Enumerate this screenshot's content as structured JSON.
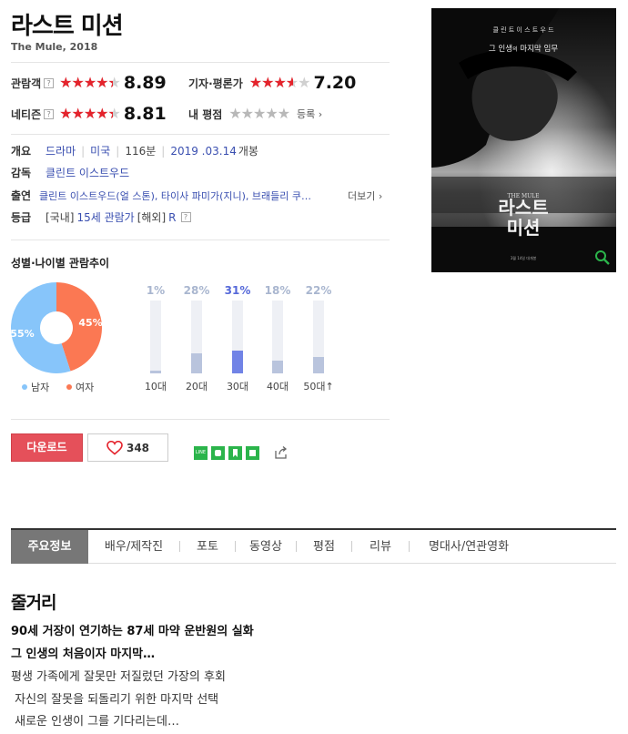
{
  "movie": {
    "title": "라스트 미션",
    "subtitle": "The Mule, 2018"
  },
  "ratings": {
    "audience": {
      "label": "관람객",
      "help": "?",
      "score": "8.89",
      "fraction": 0.889
    },
    "critics": {
      "label": "기자·평론가",
      "score": "7.20",
      "fraction": 0.72
    },
    "netizen": {
      "label": "네티즌",
      "help": "?",
      "score": "8.81",
      "fraction": 0.881
    },
    "mine": {
      "label": "내 평점",
      "action": "등록 ›",
      "fraction": 0
    }
  },
  "stars_glyphs": "★★★★★",
  "info": {
    "overview": {
      "key": "개요",
      "genre": "드라마",
      "country": "미국",
      "runtime": "116분",
      "release_date": "2019 .03.14",
      "release_suffix": "개봉"
    },
    "director": {
      "key": "감독",
      "name": "클린트 이스트우드"
    },
    "cast": {
      "key": "출연",
      "text": "클린트 이스트우드(얼 스톤), 타이사 파미가(지니), 브래들리 쿠…",
      "more": "더보기 ›"
    },
    "grade": {
      "key": "등급",
      "prefix": "[국내]",
      "domestic": "15세 관람가",
      "overseas_label": "[해외]",
      "overseas": "R",
      "help": "?"
    }
  },
  "demographics": {
    "title": "성별·나이별 관람추이",
    "gender": [
      {
        "name": "남자",
        "percent": 55,
        "label": "55%",
        "color": "#87c5fa"
      },
      {
        "name": "여자",
        "percent": 45,
        "label": "45%",
        "color": "#fb7853"
      }
    ],
    "age": [
      {
        "name": "10대",
        "percent": 1,
        "label": "1%",
        "highlight": false
      },
      {
        "name": "20대",
        "percent": 28,
        "label": "28%",
        "highlight": false
      },
      {
        "name": "30대",
        "percent": 31,
        "label": "31%",
        "highlight": true
      },
      {
        "name": "40대",
        "percent": 18,
        "label": "18%",
        "highlight": false
      },
      {
        "name": "50대↑",
        "percent": 22,
        "label": "22%",
        "highlight": false
      }
    ]
  },
  "actions": {
    "download": "다운로드",
    "like_count": "348"
  },
  "share": [
    {
      "name": "line-icon",
      "text": "LINE"
    },
    {
      "name": "band-icon",
      "text": ""
    },
    {
      "name": "bookmark-icon",
      "text": ""
    },
    {
      "name": "memo-icon",
      "text": ""
    }
  ],
  "poster": {
    "top_credit": "클 린 트   이 스 트 우 드",
    "tagline_a": "그 인생",
    "tagline_b": "의",
    "tagline_c": " 마지막 임무",
    "mule": "THE MULE",
    "title": "라스트\n미션",
    "release_note": "3월 14일 대개봉"
  },
  "tabs": [
    "주요정보",
    "배우/제작진",
    "포토",
    "동영상",
    "평점",
    "리뷰",
    "명대사/연관영화"
  ],
  "plot": {
    "heading": "줄거리",
    "lines": [
      "90세 거장이 연기하는 87세 마약 운반원의 실화",
      "그 인생의 처음이자 마지막…",
      "평생 가족에게 잘못만 저질렀던 가장의 후회",
      " 자신의 잘못을 되돌리기 위한 마지막 선택",
      " 새로운 인생이 그를 기다리는데…"
    ]
  },
  "colors": {
    "star": "#e4232c",
    "link": "#3a4fb0",
    "download": "#e5505a",
    "share_green": "#2bb44b"
  }
}
